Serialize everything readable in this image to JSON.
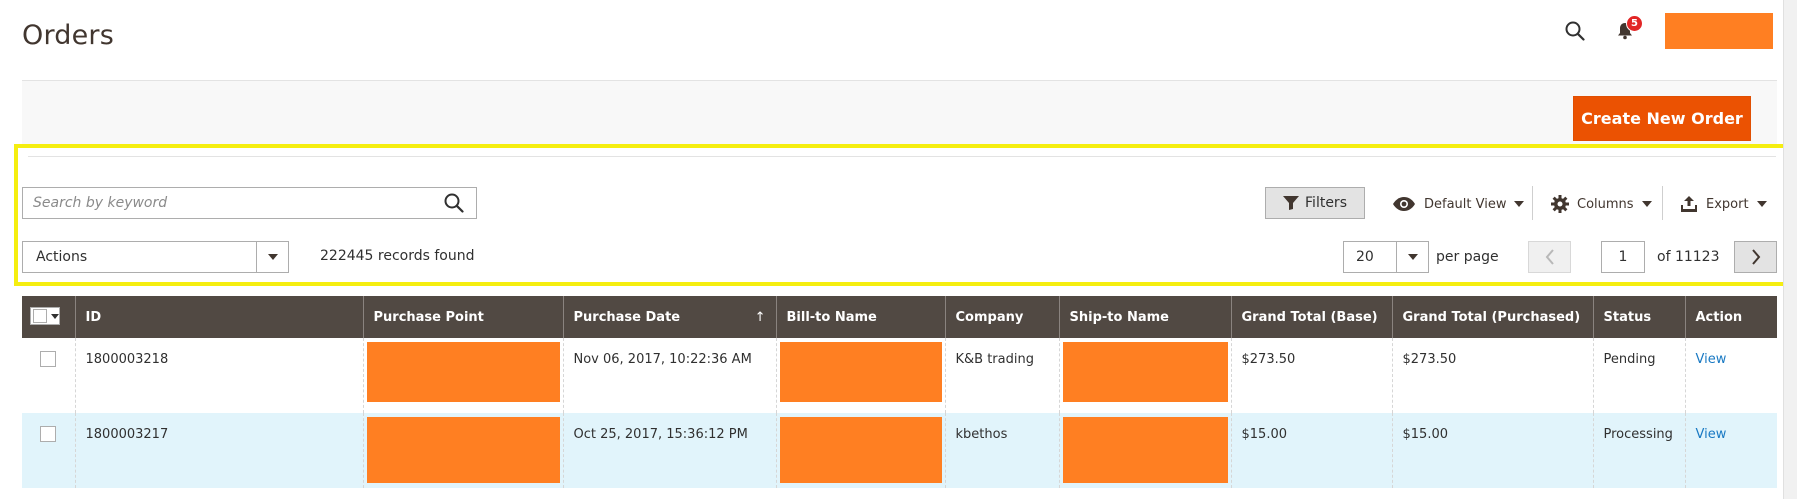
{
  "header": {
    "title": "Orders",
    "notification_count": "5",
    "icons": [
      "search-icon",
      "bell-icon"
    ],
    "user_block_color": "#ff7f22"
  },
  "page_actions": {
    "create_new_order": "Create New Order",
    "accent": "#eb5202"
  },
  "toolbar": {
    "search_placeholder": "Search by keyword",
    "search_value": "",
    "filters_label": "Filters",
    "default_view_label": "Default View",
    "columns_label": "Columns",
    "export_label": "Export",
    "actions_label": "Actions",
    "records_found": "222445 records found",
    "per_page_value": "20",
    "per_page_label": "per page",
    "page_value": "1",
    "page_of": "of 11123"
  },
  "grid": {
    "columns": [
      "ID",
      "Purchase Point",
      "Purchase Date",
      "Bill-to Name",
      "Company",
      "Ship-to Name",
      "Grand Total (Base)",
      "Grand Total (Purchased)",
      "Status",
      "Action"
    ],
    "sort_indicator": "↑",
    "rows": [
      {
        "id": "1800003218",
        "purchase_point": "",
        "purchase_date": "Nov 06, 2017, 10:22:36 AM",
        "bill_to_name": "",
        "company": "K&B trading",
        "ship_to_name": "",
        "grand_total_base": "$273.50",
        "grand_total_purchased": "$273.50",
        "status": "Pending",
        "action": "View"
      },
      {
        "id": "1800003217",
        "purchase_point": "",
        "purchase_date": "Oct 25, 2017, 15:36:12 PM",
        "bill_to_name": "",
        "company": "kbethos",
        "ship_to_name": "",
        "grand_total_base": "$15.00",
        "grand_total_purchased": "$15.00",
        "status": "Processing",
        "action": "View"
      }
    ]
  },
  "highlight_color": "#f5ee10"
}
